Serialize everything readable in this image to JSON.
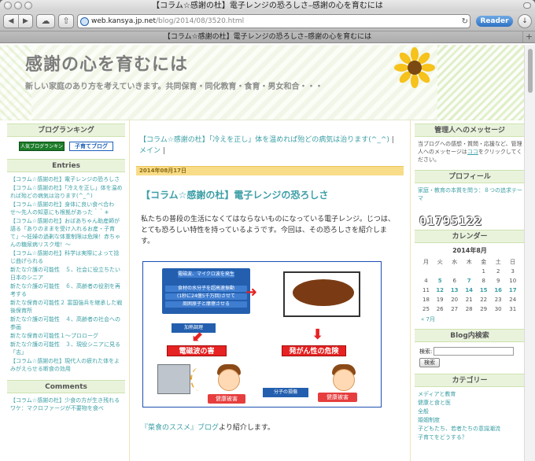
{
  "browser": {
    "window_title": "【コラム☆感謝の杜】電子レンジの恐ろしさ–感謝の心を育むには",
    "url_host": "web.kansya.jp.net",
    "url_path": "/blog/2014/08/3520.html",
    "reader_label": "Reader",
    "tab_title": "【コラム☆感謝の杜】電子レンジの恐ろしさ–感謝の心を育むには"
  },
  "site": {
    "title": "感謝の心を育むには",
    "description": "新しい家庭のあり方を考えていきます。共同保育・同化教育・食育・男女和合・・・"
  },
  "left_sidebar": {
    "ranking_title": "ブログランキング",
    "badge1": "人気ブログランキング",
    "badge2": "子育てブログ",
    "entries_title": "Entries",
    "entries": [
      "【コラム☆感謝の杜】電子レンジの恐ろしさ",
      "【コラム☆感謝の杜】「冷えを正し」体を温めれば殆どの病気は治ります(^_^)",
      "【コラム☆感謝の杜】身体に良い食べ合わせ〜先人の知恵にも根拠があった＾＾＊",
      "【コラム☆感謝の杜】おばあちゃん助産師が語る「ありのままを受け入れるお産・子育て」〜妊婦の過剰な体重制限は危険！赤ちゃんの糖尿病リスク増！〜",
      "【コラム☆感謝の杜】科学は実際によって捻じ曲げられる",
      "新たな介護の可能性　５、社会に役立ちたい日本のシニア",
      "新たな介護の可能性　６、高齢者の役割を再考する",
      "新たな保育の可能性２ 富国強兵を継承した戦後保育所",
      "新たな介護の可能性　４、高齢者の社会への参画",
      "新たな保育の可能性１〜プロローグ",
      "新たな介護の可能性　３、現役シニアに見る「志」",
      "【コラム☆感謝の杜】現代人の疲れた体をよみがえらせる断食の効用"
    ],
    "comments_title": "Comments",
    "comments": [
      "【コラム☆感謝の杜】少食の方が生き残れるワケ：マクロファージが不要物を食べ"
    ]
  },
  "main": {
    "prev_link": "【コラム☆感謝の杜】「冷えを正し」体を温めれば殆どの病気は治ります(^_^)",
    "separator1": "|",
    "main_link": "メイン",
    "separator2": "|",
    "date": "2014年08月17日",
    "post_title": "【コラム☆感謝の杜】電子レンジの恐ろしさ",
    "post_body": "私たちの普段の生活になくてはならないものになっている電子レンジ。じつは、とても恐ろしい特性を持っているようです。今回は、その恐ろしさを紹介します。",
    "figure": {
      "box_line1": "電磁波、マイクロ波を発生",
      "box_line2": "食材の水分子を超高速振動",
      "box_line3": "(1秒に24億5千万回)させて",
      "box_line4": "周囲原子と摩擦させる",
      "tag": "加熱調理",
      "warn_a": "電磁波の害",
      "warn_b": "発がん性の危険",
      "harm_a": "健康被害",
      "harm_b": "健康被害",
      "mol": "分子の損傷"
    },
    "credit_link": "『菜食のススメ』ブログ",
    "credit_text": "より紹介します。"
  },
  "right_sidebar": {
    "message_title": "管理人へのメッセージ",
    "message_text_1": "当ブログへの感想・質問・応援など、管理人へのメッセージは",
    "message_link": "ココ",
    "message_text_2": "をクリックしてください。",
    "profile_title": "プロフィール",
    "profile_text": "家庭・教育の本質を問う：８つの追求テーマ",
    "counter": "01795122",
    "calendar_title": "カレンダー",
    "calendar_caption": "2014年8月",
    "weekdays": [
      "月",
      "火",
      "水",
      "木",
      "金",
      "土",
      "日"
    ],
    "weeks": [
      [
        "",
        "",
        "",
        "",
        "1",
        "2",
        "3"
      ],
      [
        "4",
        "5",
        "6",
        "7",
        "8",
        "9",
        "10"
      ],
      [
        "11",
        "12",
        "13",
        "14",
        "15",
        "16",
        "17"
      ],
      [
        "18",
        "19",
        "20",
        "21",
        "22",
        "23",
        "24"
      ],
      [
        "25",
        "26",
        "27",
        "28",
        "29",
        "30",
        "31"
      ]
    ],
    "calendar_prev": "« 7月",
    "search_title": "Blog内検索",
    "search_label": "検索:",
    "search_button": "検索",
    "category_title": "カテゴリー",
    "categories": [
      "メディアと教育",
      "健康と食と医",
      "全般",
      "婚姻制度",
      "子どもたち、若者たちの意識潮流",
      "子育てをどうする？"
    ]
  }
}
